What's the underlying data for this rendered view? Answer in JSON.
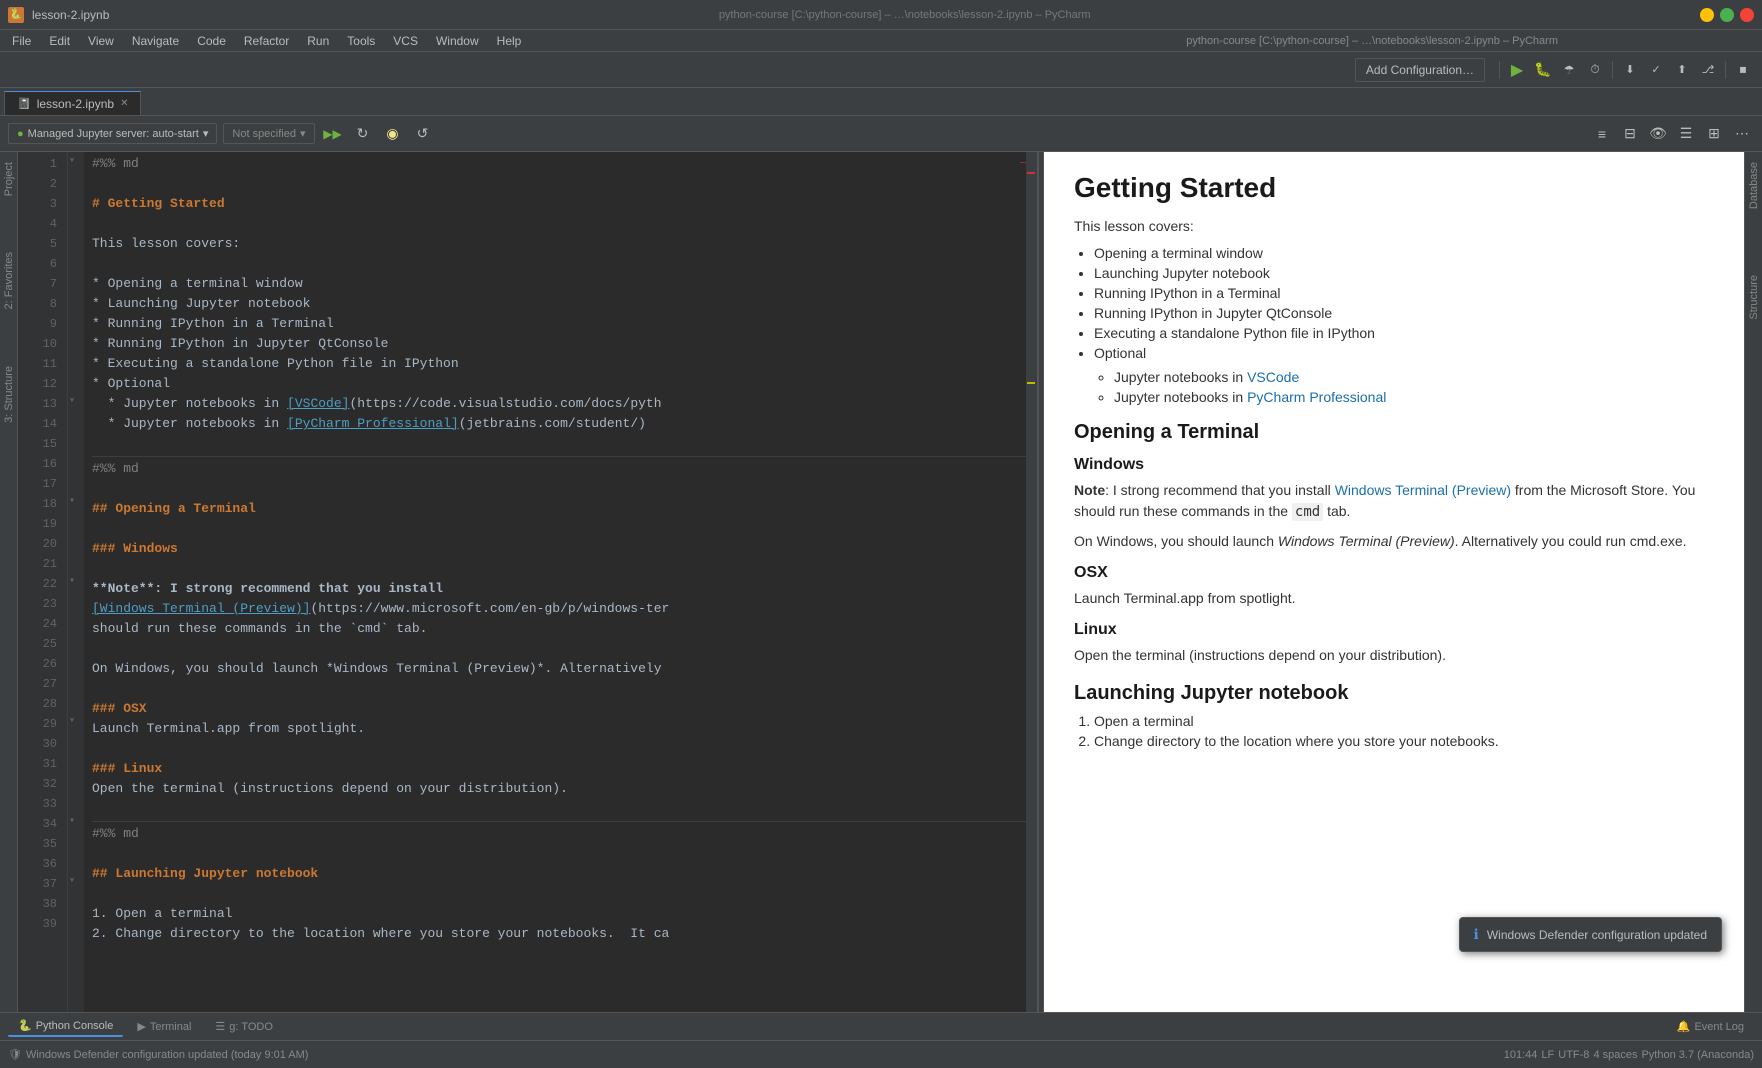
{
  "window": {
    "title": "lesson-2.ipynb – …\\notebooks\\lesson-2.ipynb – PyCharm",
    "file_icon": "🐍"
  },
  "title_bar": {
    "app_title": "lesson-2.ipynb",
    "full_path": "python-course [C:\\python-course] – …\\notebooks\\lesson-2.ipynb – PyCharm",
    "minimize": "—",
    "maximize": "□",
    "close": "✕"
  },
  "menu": {
    "items": [
      "File",
      "Edit",
      "View",
      "Navigate",
      "Code",
      "Refactor",
      "Run",
      "Tools",
      "VCS",
      "Window",
      "Help"
    ]
  },
  "toolbar": {
    "add_config_label": "Add Configuration…",
    "run_icon": "▶",
    "debug_icon": "🐛",
    "coverage_icon": "☂",
    "profile_icon": "⏱",
    "record_icon": "⏺",
    "stop_icon": "⏹",
    "search_icon": "🔍"
  },
  "tabs": {
    "active_tab": "lesson-2.ipynb",
    "items": [
      {
        "label": "lesson-2.ipynb",
        "active": true
      }
    ]
  },
  "jupyter_toolbar": {
    "server_label": "Managed Jupyter server: auto-start",
    "kernel_label": "Not specified",
    "run_btn": "▶",
    "restart_btn": "↺",
    "more_btn": "⋯"
  },
  "editor": {
    "lines": [
      {
        "num": 1,
        "content": "#%% md",
        "type": "cell-marker"
      },
      {
        "num": 2,
        "content": "",
        "type": "empty"
      },
      {
        "num": 3,
        "content": "# Getting Started",
        "type": "heading1"
      },
      {
        "num": 4,
        "content": "",
        "type": "empty"
      },
      {
        "num": 5,
        "content": "This lesson covers:",
        "type": "text"
      },
      {
        "num": 6,
        "content": "",
        "type": "empty"
      },
      {
        "num": 7,
        "content": "* Opening a terminal window",
        "type": "bullet"
      },
      {
        "num": 8,
        "content": "* Launching Jupyter notebook",
        "type": "bullet"
      },
      {
        "num": 9,
        "content": "* Running IPython in a Terminal",
        "type": "bullet"
      },
      {
        "num": 10,
        "content": "* Running IPython in Jupyter QtConsole",
        "type": "bullet"
      },
      {
        "num": 11,
        "content": "* Executing a standalone Python file in IPython",
        "type": "bullet"
      },
      {
        "num": 12,
        "content": "* Optional",
        "type": "bullet"
      },
      {
        "num": 13,
        "content": "  * Jupyter notebooks in [VSCode](https://code.visualstudio.com/docs/pyth",
        "type": "bullet-link"
      },
      {
        "num": 14,
        "content": "  * Jupyter notebooks in [PyCharm Professional](jetbrains.com/student/)",
        "type": "bullet-link"
      },
      {
        "num": 15,
        "content": "",
        "type": "empty"
      },
      {
        "num": 16,
        "content": "#%% md",
        "type": "cell-marker"
      },
      {
        "num": 17,
        "content": "",
        "type": "empty"
      },
      {
        "num": 18,
        "content": "## Opening a Terminal",
        "type": "heading2"
      },
      {
        "num": 19,
        "content": "",
        "type": "empty"
      },
      {
        "num": 20,
        "content": "### Windows",
        "type": "heading3"
      },
      {
        "num": 21,
        "content": "",
        "type": "empty"
      },
      {
        "num": 22,
        "content": "**Note**: I strong recommend that you install",
        "type": "bold-text"
      },
      {
        "num": 23,
        "content": "[Windows Terminal (Preview)](https://www.microsoft.com/en-gb/p/windows-ter",
        "type": "link"
      },
      {
        "num": 24,
        "content": "should run these commands in the `cmd` tab.",
        "type": "text"
      },
      {
        "num": 25,
        "content": "",
        "type": "empty"
      },
      {
        "num": 26,
        "content": "On Windows, you should launch *Windows Terminal (Preview)*. Alternatively",
        "type": "text"
      },
      {
        "num": 27,
        "content": "",
        "type": "empty"
      },
      {
        "num": 28,
        "content": "### OSX",
        "type": "heading3"
      },
      {
        "num": 29,
        "content": "Launch Terminal.app from spotlight.",
        "type": "text"
      },
      {
        "num": 30,
        "content": "",
        "type": "empty"
      },
      {
        "num": 31,
        "content": "### Linux",
        "type": "heading3"
      },
      {
        "num": 32,
        "content": "Open the terminal (instructions depend on your distribution).",
        "type": "text"
      },
      {
        "num": 33,
        "content": "",
        "type": "empty"
      },
      {
        "num": 34,
        "content": "#%% md",
        "type": "cell-marker"
      },
      {
        "num": 35,
        "content": "",
        "type": "empty"
      },
      {
        "num": 36,
        "content": "## Launching Jupyter notebook",
        "type": "heading2"
      },
      {
        "num": 37,
        "content": "",
        "type": "empty"
      },
      {
        "num": 38,
        "content": "1. Open a terminal",
        "type": "ordered"
      },
      {
        "num": 39,
        "content": "2. Change directory to the location where you store your notebooks.  It ca",
        "type": "ordered"
      }
    ]
  },
  "preview": {
    "h1": "Getting Started",
    "intro": "This lesson covers:",
    "bullets": [
      "Opening a terminal window",
      "Launching Jupyter notebook",
      "Running IPython in a Terminal",
      "Running IPython in Jupyter QtConsole",
      "Executing a standalone Python file in IPython",
      "Optional"
    ],
    "optional_sub": [
      {
        "text": "Jupyter notebooks in ",
        "link_text": "VSCode",
        "link_href": "#"
      },
      {
        "text": "Jupyter notebooks in ",
        "link_text": "PyCharm Professional",
        "link_href": "#"
      }
    ],
    "h2_terminal": "Opening a Terminal",
    "h3_windows": "Windows",
    "windows_note": "Note: I strong recommend that you install Windows Terminal (Preview) from the Microsoft Store. You should run these commands in the ",
    "windows_cmd": "cmd",
    "windows_note2": " tab.",
    "windows_p": "On Windows, you should launch Windows Terminal (Preview). Alternatively you could run cmd.exe.",
    "h3_osx": "OSX",
    "osx_p": "Launch Terminal.app from spotlight.",
    "h3_linux": "Linux",
    "linux_p": "Open the terminal (instructions depend on your distribution).",
    "h2_jupyter": "Launching Jupyter notebook",
    "jupyter_li1": "Open a terminal",
    "jupyter_li2": "Change directory to the location where you store your notebooks."
  },
  "bottom_tabs": {
    "items": [
      {
        "label": "Python Console",
        "icon": "🐍",
        "active": true
      },
      {
        "label": "Terminal",
        "icon": "▶",
        "active": false
      },
      {
        "label": "g: TODO",
        "icon": "☰",
        "active": false
      }
    ],
    "event_log": "Event Log"
  },
  "status_bar": {
    "message": "Windows Defender configuration updated (today 9:01 AM)",
    "position": "101:44",
    "encoding": "LF",
    "charset": "UTF-8",
    "indent": "4 spaces",
    "python": "Python 3.7 (Anaconda)"
  },
  "notification": {
    "icon": "ℹ",
    "text": "Windows Defender configuration updated"
  },
  "right_labels": {
    "database": "Database",
    "structure": "Structure"
  },
  "left_labels": {
    "project": "Project",
    "favorites": "2: Favorites",
    "structure": "3: Structure"
  }
}
